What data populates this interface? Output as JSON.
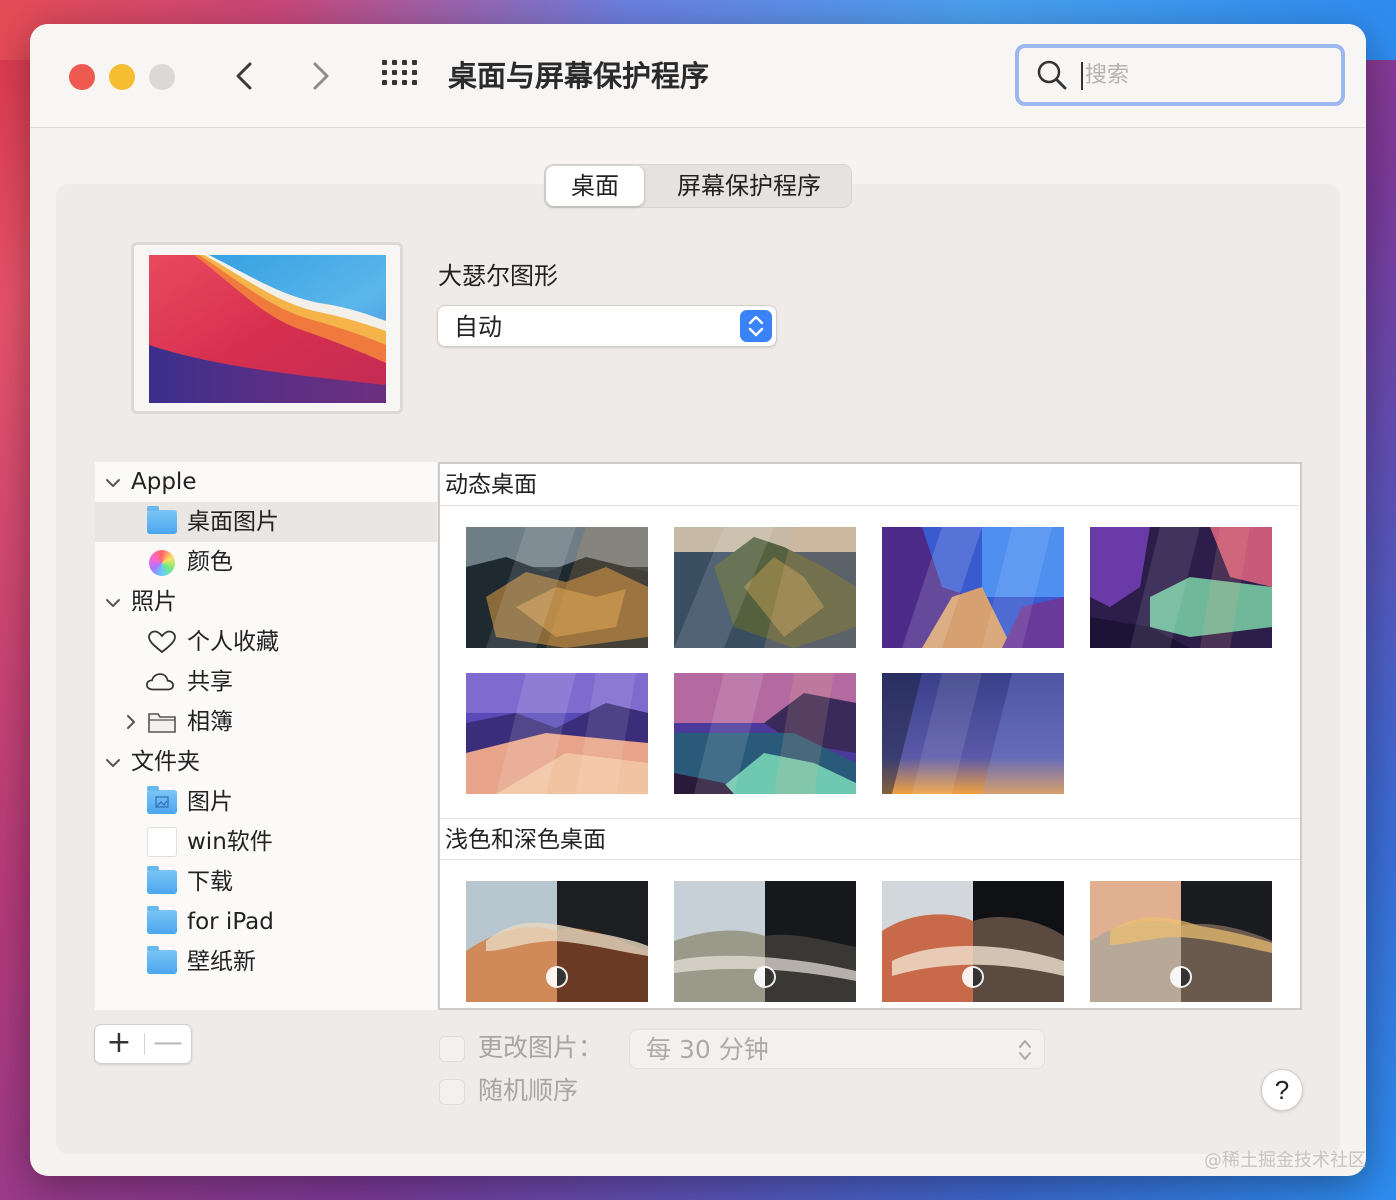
{
  "window": {
    "title": "桌面与屏幕保护程序",
    "search_placeholder": "搜索"
  },
  "tabs": [
    {
      "label": "桌面",
      "active": true
    },
    {
      "label": "屏幕保护程序",
      "active": false
    }
  ],
  "current_wallpaper": {
    "name": "大瑟尔图形",
    "mode": "自动"
  },
  "sidebar": {
    "groups": [
      {
        "label": "Apple",
        "expanded": true,
        "items": [
          {
            "label": "桌面图片",
            "icon": "folder-icon",
            "selected": true
          },
          {
            "label": "颜色",
            "icon": "color-wheel-icon"
          }
        ]
      },
      {
        "label": "照片",
        "expanded": true,
        "items": [
          {
            "label": "个人收藏",
            "icon": "heart-icon"
          },
          {
            "label": "共享",
            "icon": "cloud-icon"
          },
          {
            "label": "相簿",
            "icon": "folder-icon"
          }
        ]
      },
      {
        "label": "文件夹",
        "expanded": true,
        "items": [
          {
            "label": "图片",
            "icon": "pictures-folder-icon"
          },
          {
            "label": "win软件",
            "icon": "blank-file-icon"
          },
          {
            "label": "下载",
            "icon": "folder-icon"
          },
          {
            "label": "for iPad",
            "icon": "folder-icon"
          },
          {
            "label": "壁纸新",
            "icon": "folder-icon"
          }
        ]
      }
    ]
  },
  "gallery": {
    "sections": [
      {
        "title": "动态桌面",
        "count": 7
      },
      {
        "title": "浅色和深色桌面",
        "count": 4
      }
    ]
  },
  "footer": {
    "plus_label": "+",
    "minus_label": "—",
    "change_picture_label": "更改图片：",
    "interval_value": "每 30 分钟",
    "random_order_label": "随机顺序",
    "help_label": "?"
  },
  "watermark": "@稀土掘金技术社区",
  "colors": {
    "accent": "#3a82f7",
    "close": "#ef5a50",
    "minimize": "#f5be30",
    "search_focus": "#9db8ef"
  }
}
